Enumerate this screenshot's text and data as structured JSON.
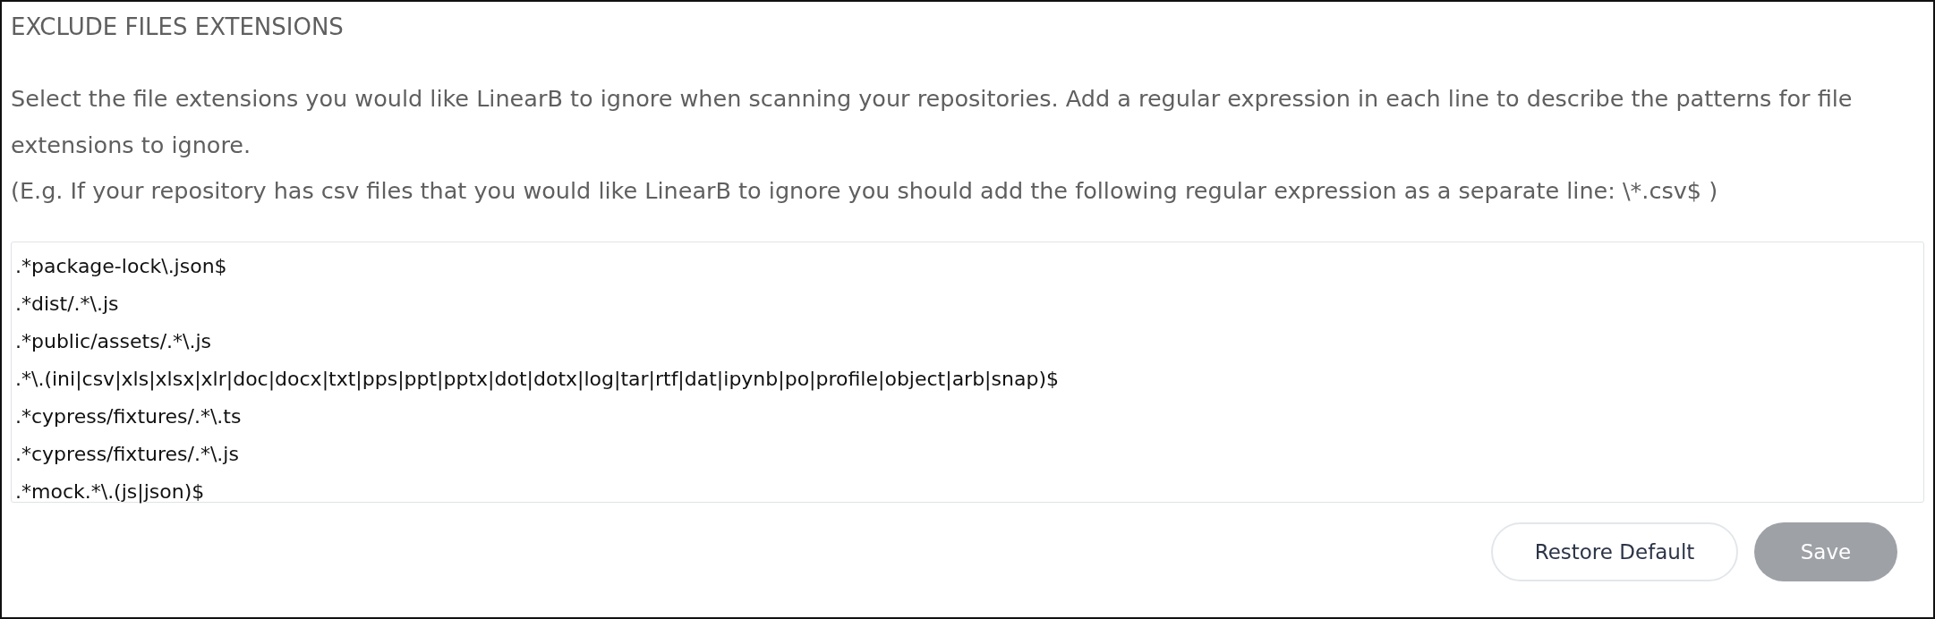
{
  "title": "EXCLUDE FILES EXTENSIONS",
  "description": "Select the file extensions you would like LinearB to ignore when scanning your repositories. Add a regular expression in each line to describe the patterns for file extensions to ignore.",
  "example": "(E.g. If your repository has csv files that you would like LinearB to ignore you should add the following regular expression as a separate line: \\*.csv$ )",
  "patterns": [
    ".*package-lock\\.json$",
    ".*dist/.*\\.js",
    ".*public/assets/.*\\.js",
    ".*\\.(ini|csv|xls|xlsx|xlr|doc|docx|txt|pps|ppt|pptx|dot|dotx|log|tar|rtf|dat|ipynb|po|profile|object|arb|snap)$",
    ".*cypress/fixtures/.*\\.ts",
    ".*cypress/fixtures/.*\\.js",
    ".*mock.*\\.(js|json)$"
  ],
  "buttons": [
    {
      "kind": "secondary",
      "label": "Restore Default",
      "disabled": false
    },
    {
      "kind": "primary",
      "label": "Save",
      "disabled": true
    }
  ]
}
